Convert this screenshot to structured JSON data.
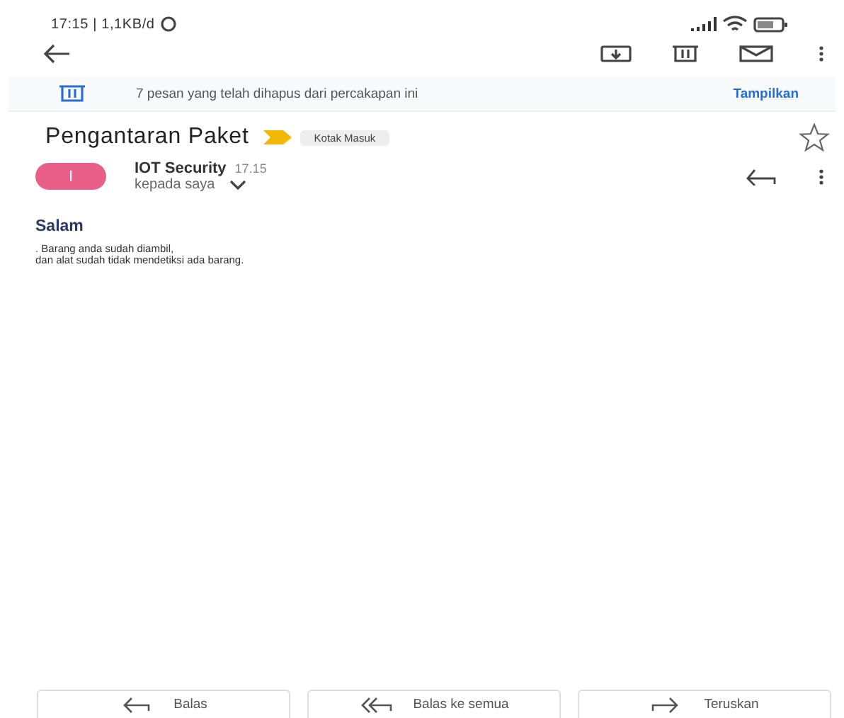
{
  "status_bar": {
    "time": "17:15 | 1,1KB/d"
  },
  "deleted_notice": {
    "text": "7 pesan yang telah dihapus dari percakapan ini",
    "action": "Tampilkan"
  },
  "subject": {
    "title": "Pengantaran Paket",
    "label": "Kotak Masuk",
    "starred": false
  },
  "message": {
    "avatar": "I",
    "sender": "IOT Security",
    "time": "17.15",
    "recipient": "kepada saya",
    "greeting": "Salam",
    "body": [
      ". Barang anda sudah diambil,",
      "dan alat sudah tidak mendetiksi ada barang."
    ]
  },
  "actions": [
    {
      "kind": "reply",
      "label": "Balas"
    },
    {
      "kind": "reply-all",
      "label": "Balas ke semua"
    },
    {
      "kind": "forward",
      "label": "Teruskan"
    }
  ]
}
